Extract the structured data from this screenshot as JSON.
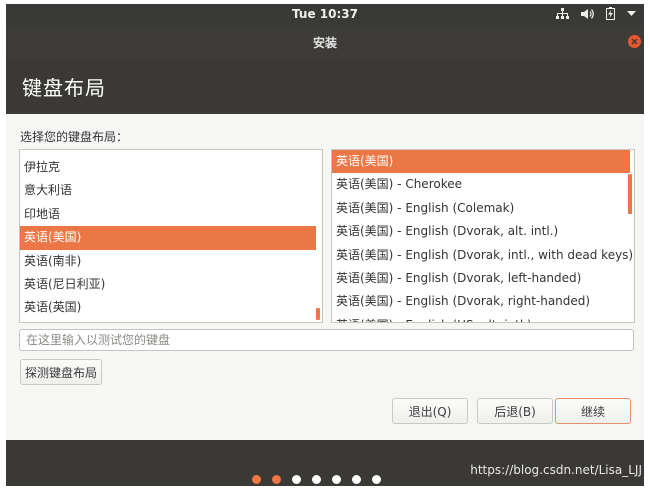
{
  "topbar": {
    "clock": "Tue 10:37",
    "icons": [
      "network-icon",
      "volume-icon",
      "battery-icon",
      "system-menu-chevron-icon"
    ]
  },
  "window": {
    "title": "安装",
    "close_color": "#e9562c"
  },
  "banner": {
    "title": "键盘布局"
  },
  "main": {
    "prompt": "选择您的键盘布局：",
    "layouts": [
      {
        "label": "伊拉克",
        "selected": false
      },
      {
        "label": "意大利语",
        "selected": false
      },
      {
        "label": "印地语",
        "selected": false
      },
      {
        "label": "英语(美国)",
        "selected": true
      },
      {
        "label": "英语(南非)",
        "selected": false
      },
      {
        "label": "英语(尼日利亚)",
        "selected": false
      },
      {
        "label": "英语(英国)",
        "selected": false
      }
    ],
    "variants": [
      {
        "label": "英语(美国)",
        "selected": true
      },
      {
        "label": "英语(美国) - Cherokee",
        "selected": false
      },
      {
        "label": "英语(美国) - English (Colemak)",
        "selected": false
      },
      {
        "label": "英语(美国) - English (Dvorak, alt. intl.)",
        "selected": false
      },
      {
        "label": "英语(美国) - English (Dvorak, intl., with dead keys)",
        "selected": false
      },
      {
        "label": "英语(美国) - English (Dvorak, left-handed)",
        "selected": false
      },
      {
        "label": "英语(美国) - English (Dvorak, right-handed)",
        "selected": false
      },
      {
        "label": "英语(美国) - English (US, alt. intl.)",
        "selected": false
      }
    ],
    "test_placeholder": "在这里输入以测试您的键盘",
    "test_value": "",
    "detect_label": "探测键盘布局"
  },
  "buttons": {
    "quit": "退出(Q)",
    "back": "后退(B)",
    "continue": "继续"
  },
  "progress": {
    "total_steps": 7,
    "completed_steps": 2
  },
  "watermark": "https://blog.csdn.net/Lisa_LJJ",
  "colors": {
    "accent": "#ec7746",
    "header": "#3d3c38",
    "topbar": "#393937"
  }
}
